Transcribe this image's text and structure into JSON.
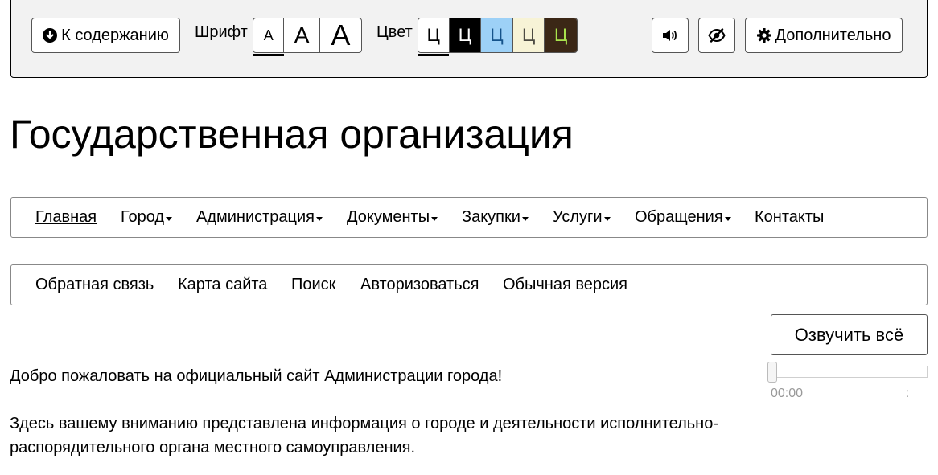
{
  "accessibility_bar": {
    "skip_label": "К содержанию",
    "font_label": "Шрифт",
    "font_sizes": [
      "А",
      "А",
      "А"
    ],
    "color_label": "Цвет",
    "color_schemes": [
      {
        "glyph": "Ц",
        "bg": "#ffffff",
        "fg": "#000000"
      },
      {
        "glyph": "Ц",
        "bg": "#000000",
        "fg": "#ffffff"
      },
      {
        "glyph": "Ц",
        "bg": "#9dd1f7",
        "fg": "#15538a"
      },
      {
        "glyph": "Ц",
        "bg": "#f7f3d6",
        "fg": "#4d4b43"
      },
      {
        "glyph": "Ц",
        "bg": "#3b2716",
        "fg": "#a9e44d"
      }
    ],
    "more_label": "Дополнительно",
    "icons": {
      "skip": "arrow-down-circle-icon",
      "sound": "speaker-icon",
      "images": "eye-slash-icon",
      "more": "gear-icon"
    }
  },
  "page_title": "Государственная организация",
  "main_nav": [
    {
      "label": "Главная",
      "dropdown": false,
      "active": true
    },
    {
      "label": "Город",
      "dropdown": true
    },
    {
      "label": "Администрация",
      "dropdown": true
    },
    {
      "label": "Документы",
      "dropdown": true
    },
    {
      "label": "Закупки",
      "dropdown": true
    },
    {
      "label": "Услуги",
      "dropdown": true
    },
    {
      "label": "Обращения",
      "dropdown": true
    },
    {
      "label": "Контакты",
      "dropdown": false
    }
  ],
  "secondary_nav": [
    "Обратная связь",
    "Карта сайта",
    "Поиск",
    "Авторизоваться",
    "Обычная версия"
  ],
  "tts": {
    "button_label": "Озвучить всё",
    "time_current": "00:00",
    "time_total": "__:__",
    "progress": 0
  },
  "content": {
    "paragraph_1": "Добро пожаловать на официальный сайт Администрации города!",
    "paragraph_2_line_1": "Здесь вашему вниманию представлена информация о городе и деятельности исполнительно-",
    "paragraph_2_line_2": "распорядительного органа местного самоуправления."
  }
}
